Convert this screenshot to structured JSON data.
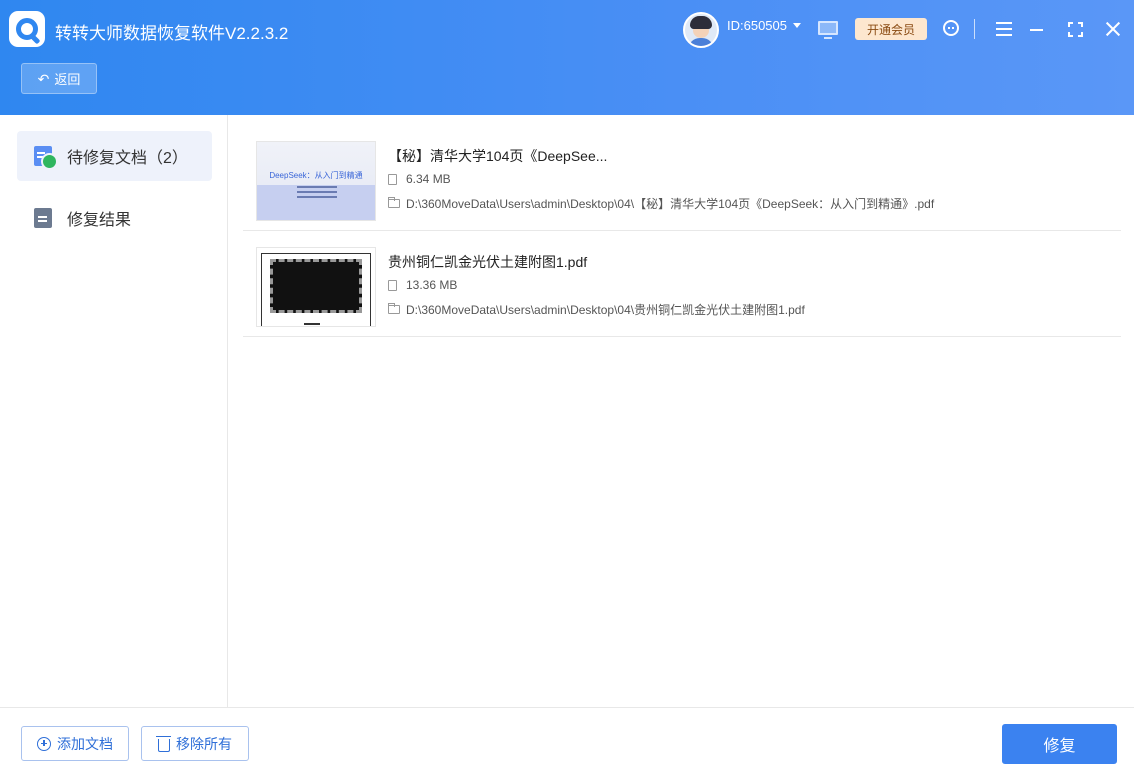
{
  "app": {
    "title": "转转大师数据恢复软件V2.2.3.2"
  },
  "header": {
    "user_id": "ID:650505",
    "vip_label": "开通会员",
    "back_label": "返回",
    "icons": [
      "app-logo-icon",
      "avatar",
      "chevron-down-icon",
      "monitor-icon",
      "vip-button",
      "support-icon",
      "menu-icon",
      "minimize-icon",
      "maximize-icon",
      "close-icon"
    ]
  },
  "sidebar": {
    "items": [
      {
        "label": "待修复文档（2）",
        "icon": "doc-pending-icon",
        "active": true
      },
      {
        "label": "修复结果",
        "icon": "doc-result-icon",
        "active": false
      }
    ]
  },
  "files": [
    {
      "name": "【秘】清华大学104页《DeepSee...",
      "size": "6.34 MB",
      "path": "D:\\360MoveData\\Users\\admin\\Desktop\\04\\【秘】清华大学104页《DeepSeek：从入门到精通》.pdf",
      "thumb_title": "DeepSeek：从入门到精通"
    },
    {
      "name": "贵州铜仁凯金光伏土建附图1.pdf",
      "size": "13.36 MB",
      "path": "D:\\360MoveData\\Users\\admin\\Desktop\\04\\贵州铜仁凯金光伏土建附图1.pdf"
    }
  ],
  "footer": {
    "add_label": "添加文档",
    "remove_label": "移除所有",
    "repair_label": "修复"
  },
  "colors": {
    "header_gradient_start": "#2f87f0",
    "header_gradient_end": "#5a97f7",
    "primary_button": "#3b82f0",
    "vip_bg": "#fde7cf"
  }
}
